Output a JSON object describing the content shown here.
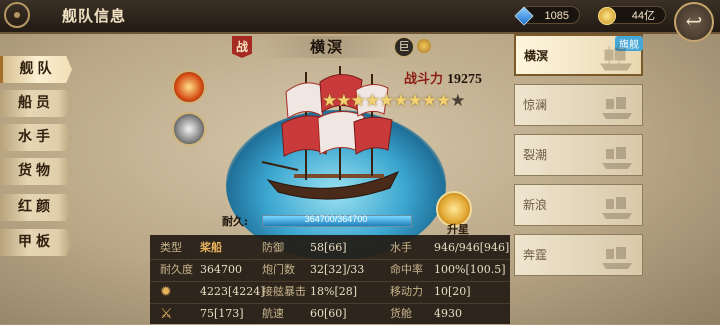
{
  "header": {
    "title": "舰队信息",
    "gems": "1085",
    "coins": "44亿",
    "back_glyph": "↩"
  },
  "sidebar": {
    "items": [
      {
        "label": "舰队",
        "active": true
      },
      {
        "label": "船员",
        "active": false
      },
      {
        "label": "水手",
        "active": false
      },
      {
        "label": "货物",
        "active": false
      },
      {
        "label": "红颜",
        "active": false
      },
      {
        "label": "甲板",
        "active": false
      }
    ]
  },
  "ship": {
    "class_badge": "战",
    "name": "横溟",
    "size_badge": "巨",
    "power_label": "战斗力",
    "power_value": "19275",
    "stars_filled": 9,
    "stars_total": 10,
    "durability_label": "耐久:",
    "durability_text": "364700/364700",
    "durability_ratio": 1.0,
    "upgrade_label": "升星"
  },
  "stats": {
    "rows": [
      [
        "类型",
        "桨船",
        "防御",
        "58[66]",
        "水手",
        "946/946[946]"
      ],
      [
        "耐久度",
        "364700",
        "炮门数",
        "32[32]/33",
        "命中率",
        "100%[100.5]"
      ],
      [
        "",
        "4223[4224]",
        "接舷暴击",
        "18%[28]",
        "移动力",
        "10[20]"
      ],
      [
        "",
        "75[173]",
        "航速",
        "60[60]",
        "货舱",
        "4930"
      ]
    ]
  },
  "fleet": {
    "flag_badge": "旗舰",
    "ships": [
      {
        "name": "横溟",
        "selected": true
      },
      {
        "name": "惊澜",
        "selected": false
      },
      {
        "name": "裂潮",
        "selected": false
      },
      {
        "name": "新浪",
        "selected": false
      },
      {
        "name": "奔霆",
        "selected": false
      }
    ]
  },
  "colors": {
    "accent_red": "#a52a21",
    "sea_blue": "#3ba6cf",
    "gold": "#e4b15c"
  }
}
